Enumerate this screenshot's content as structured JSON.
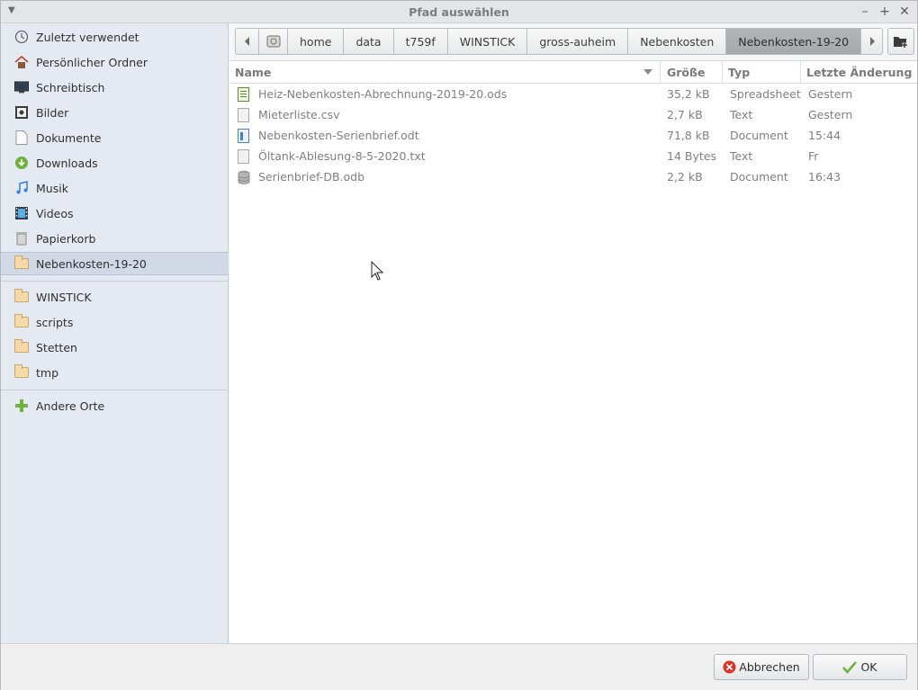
{
  "window": {
    "title": "Pfad auswählen"
  },
  "sidebar": {
    "places": [
      {
        "label": "Zuletzt verwendet",
        "icon": "recent-icon"
      },
      {
        "label": "Persönlicher Ordner",
        "icon": "home-icon"
      },
      {
        "label": "Schreibtisch",
        "icon": "desktop-icon"
      },
      {
        "label": "Bilder",
        "icon": "pictures-icon"
      },
      {
        "label": "Dokumente",
        "icon": "document-icon"
      },
      {
        "label": "Downloads",
        "icon": "download-icon"
      },
      {
        "label": "Musik",
        "icon": "music-icon"
      },
      {
        "label": "Videos",
        "icon": "video-icon"
      },
      {
        "label": "Papierkorb",
        "icon": "trash-icon"
      }
    ],
    "current": {
      "label": "Nebenkosten-19-20",
      "icon": "folder-icon"
    },
    "bookmarks": [
      {
        "label": "WINSTICK",
        "icon": "folder-icon"
      },
      {
        "label": "scripts",
        "icon": "folder-icon"
      },
      {
        "label": "Stetten",
        "icon": "folder-icon"
      },
      {
        "label": "tmp",
        "icon": "folder-icon"
      }
    ],
    "other": {
      "label": "Andere Orte",
      "icon": "plus-icon"
    }
  },
  "pathbar": {
    "crumbs": [
      "home",
      "data",
      "t759f",
      "WINSTICK",
      "gross-auheim",
      "Nebenkosten",
      "Nebenkosten-19-20"
    ],
    "selected_index": 6
  },
  "filelist": {
    "columns": {
      "name": "Name",
      "size": "Größe",
      "type": "Typ",
      "modified": "Letzte Änderung"
    },
    "files": [
      {
        "name": "Heiz-Nebenkosten-Abrechnung-2019-20.ods",
        "size": "35,2 kB",
        "type": "Spreadsheet",
        "modified": "Gestern",
        "icon": "spreadsheet-icon"
      },
      {
        "name": "Mieterliste.csv",
        "size": "2,7 kB",
        "type": "Text",
        "modified": "Gestern",
        "icon": "text-file-icon"
      },
      {
        "name": "Nebenkosten-Serienbrief.odt",
        "size": "71,8 kB",
        "type": "Document",
        "modified": "15:44",
        "icon": "writer-document-icon"
      },
      {
        "name": "Öltank-Ablesung-8-5-2020.txt",
        "size": "14 Bytes",
        "type": "Text",
        "modified": "Fr",
        "icon": "text-file-icon"
      },
      {
        "name": "Serienbrief-DB.odb",
        "size": "2,2 kB",
        "type": "Document",
        "modified": "16:43",
        "icon": "database-icon"
      }
    ]
  },
  "footer": {
    "cancel_label": "Abbrechen",
    "ok_label": "OK"
  },
  "colors": {
    "sidebar_bg": "#e5eaf2",
    "selected_crumb": "#a8aaad",
    "cancel_red": "#d9342b",
    "ok_green": "#6db33f"
  }
}
